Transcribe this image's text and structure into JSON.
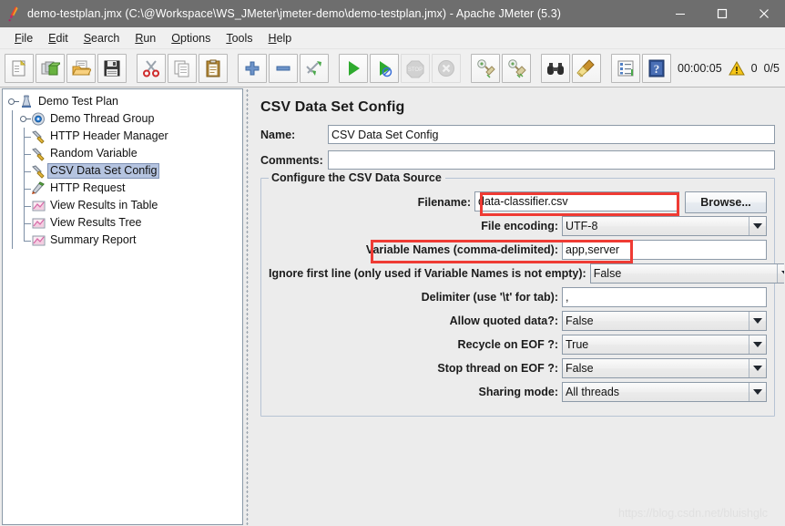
{
  "window": {
    "title": "demo-testplan.jmx (C:\\@Workspace\\WS_JMeter\\jmeter-demo\\demo-testplan.jmx) - Apache JMeter (5.3)",
    "app_icon": "jmeter-feather-icon",
    "minimize_label": "–",
    "maximize_label": "□",
    "close_label": "✕",
    "titlebar_color": "#6e6e6e"
  },
  "menubar": {
    "items": [
      {
        "mnemonic": "F",
        "rest": "ile"
      },
      {
        "mnemonic": "E",
        "rest": "dit"
      },
      {
        "mnemonic": "S",
        "rest": "earch"
      },
      {
        "mnemonic": "R",
        "rest": "un"
      },
      {
        "mnemonic": "O",
        "rest": "ptions"
      },
      {
        "mnemonic": "T",
        "rest": "ools"
      },
      {
        "mnemonic": "H",
        "rest": "elp"
      }
    ]
  },
  "toolbar": {
    "buttons": [
      {
        "name": "new-button",
        "icon": "new-document-icon"
      },
      {
        "name": "templates-button",
        "icon": "templates-icon"
      },
      {
        "name": "open-button",
        "icon": "open-folder-icon"
      },
      {
        "name": "save-button",
        "icon": "save-floppy-icon"
      },
      {
        "name": "cut-button",
        "icon": "scissors-icon"
      },
      {
        "name": "copy-button",
        "icon": "copy-pages-icon"
      },
      {
        "name": "paste-button",
        "icon": "paste-clipboard-icon"
      },
      {
        "name": "expand-all-button",
        "icon": "plus-icon"
      },
      {
        "name": "collapse-all-button",
        "icon": "minus-icon"
      },
      {
        "name": "toggle-button",
        "icon": "toggle-arrows-icon"
      },
      {
        "name": "start-button",
        "icon": "green-play-icon"
      },
      {
        "name": "start-no-pauses-button",
        "icon": "green-play-no-pause-icon"
      },
      {
        "name": "stop-button",
        "icon": "stop-sign-icon",
        "disabled": true
      },
      {
        "name": "shutdown-button",
        "icon": "shutdown-x-icon",
        "disabled": true
      },
      {
        "name": "clear-button",
        "icon": "clear-broom-icon"
      },
      {
        "name": "clear-all-button",
        "icon": "clear-all-broom-icon"
      },
      {
        "name": "search-button",
        "icon": "binoculars-icon"
      },
      {
        "name": "reset-search-button",
        "icon": "broom-icon"
      },
      {
        "name": "function-helper-button",
        "icon": "list-icon"
      },
      {
        "name": "help-button",
        "icon": "help-book-icon"
      }
    ],
    "status": {
      "elapsed_time": "00:00:05",
      "warning_icon": "warning-triangle-icon",
      "warning_count": "0",
      "threads": "0/5"
    }
  },
  "tree": {
    "nodes": [
      {
        "label": "Demo Test Plan",
        "depth": 0,
        "icon": "test-plan-icon",
        "expander": true,
        "selected": false
      },
      {
        "label": "Demo Thread Group",
        "depth": 1,
        "icon": "thread-group-icon",
        "expander": true,
        "selected": false
      },
      {
        "label": "HTTP Header Manager",
        "depth": 2,
        "icon": "config-element-icon",
        "expander": false,
        "selected": false
      },
      {
        "label": "Random Variable",
        "depth": 2,
        "icon": "config-element-icon",
        "expander": false,
        "selected": false
      },
      {
        "label": "CSV Data Set Config",
        "depth": 2,
        "icon": "config-element-icon",
        "expander": false,
        "selected": true
      },
      {
        "label": "HTTP Request",
        "depth": 2,
        "icon": "http-request-icon",
        "expander": false,
        "selected": false
      },
      {
        "label": "View Results in Table",
        "depth": 2,
        "icon": "listener-icon",
        "expander": false,
        "selected": false
      },
      {
        "label": "View Results Tree",
        "depth": 2,
        "icon": "listener-icon",
        "expander": false,
        "selected": false
      },
      {
        "label": "Summary Report",
        "depth": 2,
        "icon": "listener-icon",
        "expander": false,
        "selected": false
      }
    ]
  },
  "panel": {
    "title": "CSV Data Set Config",
    "name_label": "Name:",
    "name_value": "CSV Data Set Config",
    "comments_label": "Comments:",
    "comments_value": "",
    "group_title": "Configure the CSV Data Source",
    "rows": [
      {
        "label": "Filename:",
        "value": "data-classifier.csv",
        "type": "text",
        "highlight": true,
        "button": "Browse..."
      },
      {
        "label": "File encoding:",
        "value": "UTF-8",
        "type": "combo",
        "highlight": false
      },
      {
        "label": "Variable Names (comma-delimited):",
        "value": "app,server",
        "type": "text",
        "highlight": true
      },
      {
        "label": "Ignore first line (only used if Variable Names is not empty):",
        "value": "False",
        "type": "combo",
        "highlight": false
      },
      {
        "label": "Delimiter (use '\\t' for tab):",
        "value": ",",
        "type": "text",
        "highlight": false
      },
      {
        "label": "Allow quoted data?:",
        "value": "False",
        "type": "combo",
        "highlight": false
      },
      {
        "label": "Recycle on EOF ?:",
        "value": "True",
        "type": "combo",
        "highlight": false
      },
      {
        "label": "Stop thread on EOF ?:",
        "value": "False",
        "type": "combo",
        "highlight": false
      },
      {
        "label": "Sharing mode:",
        "value": "All threads",
        "type": "combo",
        "highlight": false
      }
    ],
    "highlight_color": "#ef3b34"
  },
  "watermark": {
    "text": "https://blog.csdn.net/bluishglc"
  }
}
